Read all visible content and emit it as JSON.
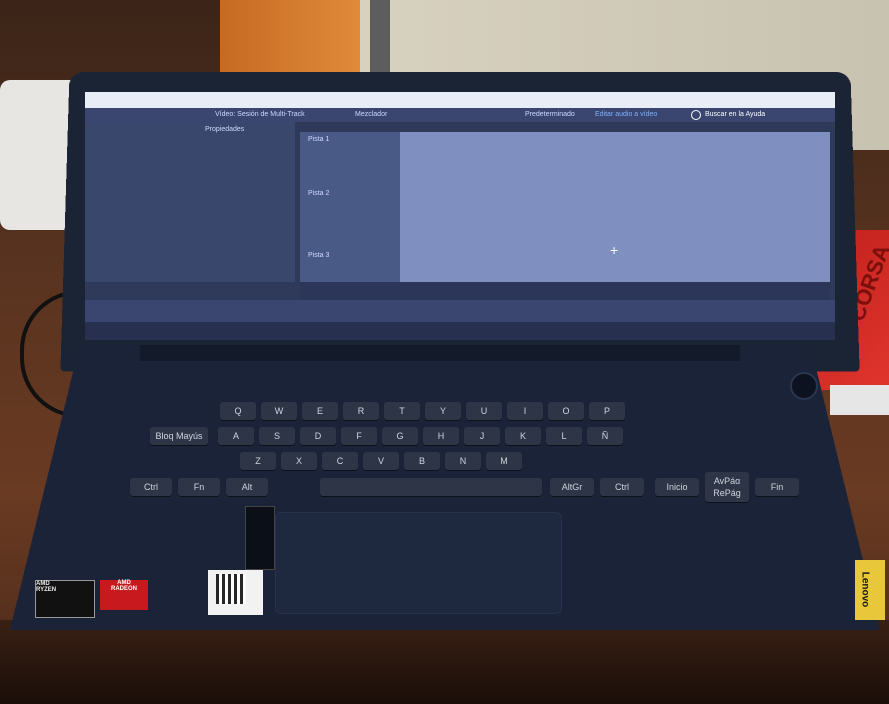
{
  "screen": {
    "app_panel_title": "Propiedades",
    "center_tab": "Vídeo: Sesión de Multi-Track",
    "mixer_tab": "Mezclador",
    "workspace": "Predeterminado",
    "menu_label": "Editar audio a vídeo",
    "search_label": "Buscar en la Ayuda",
    "track1": "Pista 1",
    "track2": "Pista 2",
    "track3": "Pista 3"
  },
  "keyboard": {
    "row_q": [
      "Q",
      "W",
      "E",
      "R",
      "T",
      "Y",
      "U",
      "I",
      "O",
      "P"
    ],
    "row_a": [
      "Bloq Mayús",
      "A",
      "S",
      "D",
      "F",
      "G",
      "H",
      "J",
      "K",
      "L",
      "Ñ"
    ],
    "row_z": [
      "Z",
      "X",
      "C",
      "V",
      "B",
      "N",
      "M"
    ],
    "bottom": [
      "Ctrl",
      "Fn",
      "Alt",
      "AltGr",
      "Ctrl",
      "Inicio",
      "AvPág",
      "RePág",
      "Fin"
    ]
  },
  "stickers": {
    "amd_brand": "AMD",
    "amd_ryzen": "RYZEN",
    "amd_radeon_brand": "AMD",
    "amd_radeon": "RADEON",
    "laptop_brand": "Lenovo"
  },
  "background": {
    "red_book_text": "CORSA"
  }
}
